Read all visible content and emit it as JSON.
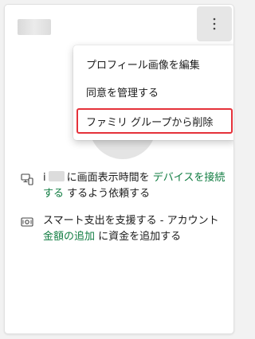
{
  "member_card": {
    "more_options_icon": "more-vertical-icon"
  },
  "menu": {
    "items": [
      {
        "label": "プロフィール画像を編集"
      },
      {
        "label": "同意を管理する"
      },
      {
        "label": "ファミリ グループから削除"
      }
    ]
  },
  "screen_time": {
    "icon": "devices-icon",
    "prefix": "i",
    "text_before_link": "に画面表示時間を",
    "link": "デバイスを接続する",
    "text_after_link": "するよう依頼する"
  },
  "spending": {
    "icon": "wallet-icon",
    "text": "スマート支出を支援する - アカウント",
    "link": "金額の追加",
    "text_after_link": "に資金を追加する"
  },
  "colors": {
    "link": "#107c41",
    "highlight": "#e5313a"
  }
}
